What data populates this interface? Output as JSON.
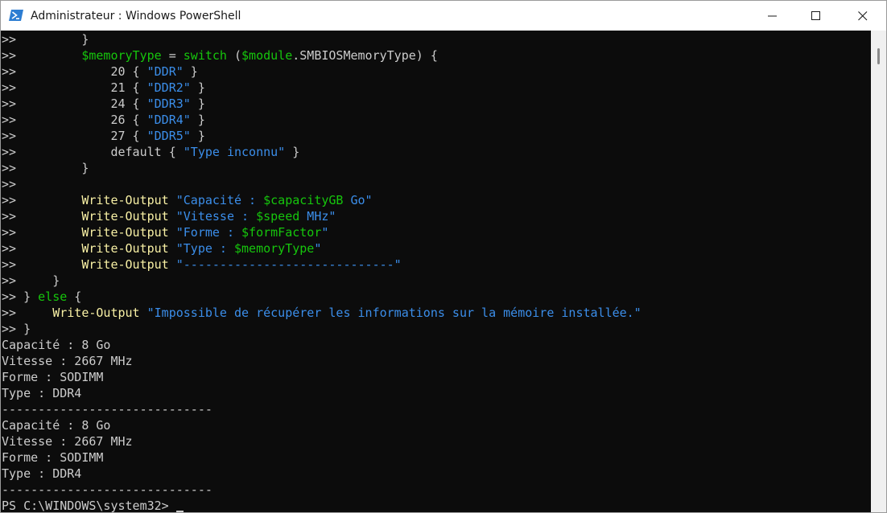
{
  "window": {
    "title": "Administrateur : Windows PowerShell",
    "app_icon": "powershell-icon",
    "controls": {
      "minimize_icon": "minimize-icon",
      "maximize_icon": "maximize-icon",
      "close_icon": "close-icon"
    }
  },
  "colors": {
    "console_bg": "#0c0c0c",
    "text": "#cccccc",
    "cmdlet": "#f9f1a5",
    "string": "#3b8eea",
    "variable": "#16c60c",
    "keyword": "#16c60c",
    "titlebar_bg": "#ffffff"
  },
  "console": {
    "lines": [
      [
        {
          "t": ">>         }",
          "c": "def"
        }
      ],
      [
        {
          "t": ">>         ",
          "c": "def"
        },
        {
          "t": "$memoryType",
          "c": "var"
        },
        {
          "t": " = ",
          "c": "def"
        },
        {
          "t": "switch",
          "c": "kw"
        },
        {
          "t": " (",
          "c": "def"
        },
        {
          "t": "$module",
          "c": "var"
        },
        {
          "t": ".SMBIOSMemoryType) {",
          "c": "def"
        }
      ],
      [
        {
          "t": ">>             20 { ",
          "c": "def"
        },
        {
          "t": "\"DDR\"",
          "c": "str"
        },
        {
          "t": " }",
          "c": "def"
        }
      ],
      [
        {
          "t": ">>             21 { ",
          "c": "def"
        },
        {
          "t": "\"DDR2\"",
          "c": "str"
        },
        {
          "t": " }",
          "c": "def"
        }
      ],
      [
        {
          "t": ">>             24 { ",
          "c": "def"
        },
        {
          "t": "\"DDR3\"",
          "c": "str"
        },
        {
          "t": " }",
          "c": "def"
        }
      ],
      [
        {
          "t": ">>             26 { ",
          "c": "def"
        },
        {
          "t": "\"DDR4\"",
          "c": "str"
        },
        {
          "t": " }",
          "c": "def"
        }
      ],
      [
        {
          "t": ">>             27 { ",
          "c": "def"
        },
        {
          "t": "\"DDR5\"",
          "c": "str"
        },
        {
          "t": " }",
          "c": "def"
        }
      ],
      [
        {
          "t": ">>             default { ",
          "c": "def"
        },
        {
          "t": "\"Type inconnu\"",
          "c": "str"
        },
        {
          "t": " }",
          "c": "def"
        }
      ],
      [
        {
          "t": ">>         }",
          "c": "def"
        }
      ],
      [
        {
          "t": ">>",
          "c": "def"
        }
      ],
      [
        {
          "t": ">>         ",
          "c": "def"
        },
        {
          "t": "Write-Output",
          "c": "cmd"
        },
        {
          "t": " ",
          "c": "def"
        },
        {
          "t": "\"Capacité : ",
          "c": "str"
        },
        {
          "t": "$capacityGB",
          "c": "var"
        },
        {
          "t": " Go\"",
          "c": "str"
        }
      ],
      [
        {
          "t": ">>         ",
          "c": "def"
        },
        {
          "t": "Write-Output",
          "c": "cmd"
        },
        {
          "t": " ",
          "c": "def"
        },
        {
          "t": "\"Vitesse : ",
          "c": "str"
        },
        {
          "t": "$speed",
          "c": "var"
        },
        {
          "t": " MHz\"",
          "c": "str"
        }
      ],
      [
        {
          "t": ">>         ",
          "c": "def"
        },
        {
          "t": "Write-Output",
          "c": "cmd"
        },
        {
          "t": " ",
          "c": "def"
        },
        {
          "t": "\"Forme : ",
          "c": "str"
        },
        {
          "t": "$formFactor",
          "c": "var"
        },
        {
          "t": "\"",
          "c": "str"
        }
      ],
      [
        {
          "t": ">>         ",
          "c": "def"
        },
        {
          "t": "Write-Output",
          "c": "cmd"
        },
        {
          "t": " ",
          "c": "def"
        },
        {
          "t": "\"Type : ",
          "c": "str"
        },
        {
          "t": "$memoryType",
          "c": "var"
        },
        {
          "t": "\"",
          "c": "str"
        }
      ],
      [
        {
          "t": ">>         ",
          "c": "def"
        },
        {
          "t": "Write-Output",
          "c": "cmd"
        },
        {
          "t": " ",
          "c": "def"
        },
        {
          "t": "\"-----------------------------\"",
          "c": "str"
        }
      ],
      [
        {
          "t": ">>     }",
          "c": "def"
        }
      ],
      [
        {
          "t": ">> } ",
          "c": "def"
        },
        {
          "t": "else",
          "c": "kw"
        },
        {
          "t": " {",
          "c": "def"
        }
      ],
      [
        {
          "t": ">>     ",
          "c": "def"
        },
        {
          "t": "Write-Output",
          "c": "cmd"
        },
        {
          "t": " ",
          "c": "def"
        },
        {
          "t": "\"Impossible de récupérer les informations sur la mémoire installée.\"",
          "c": "str"
        }
      ],
      [
        {
          "t": ">> }",
          "c": "def"
        }
      ],
      [
        {
          "t": "Capacité : 8 Go",
          "c": "def"
        }
      ],
      [
        {
          "t": "Vitesse : 2667 MHz",
          "c": "def"
        }
      ],
      [
        {
          "t": "Forme : SODIMM",
          "c": "def"
        }
      ],
      [
        {
          "t": "Type : DDR4",
          "c": "def"
        }
      ],
      [
        {
          "t": "-----------------------------",
          "c": "def"
        }
      ],
      [
        {
          "t": "Capacité : 8 Go",
          "c": "def"
        }
      ],
      [
        {
          "t": "Vitesse : 2667 MHz",
          "c": "def"
        }
      ],
      [
        {
          "t": "Forme : SODIMM",
          "c": "def"
        }
      ],
      [
        {
          "t": "Type : DDR4",
          "c": "def"
        }
      ],
      [
        {
          "t": "-----------------------------",
          "c": "def"
        }
      ]
    ],
    "prompt": "PS C:\\WINDOWS\\system32> "
  }
}
